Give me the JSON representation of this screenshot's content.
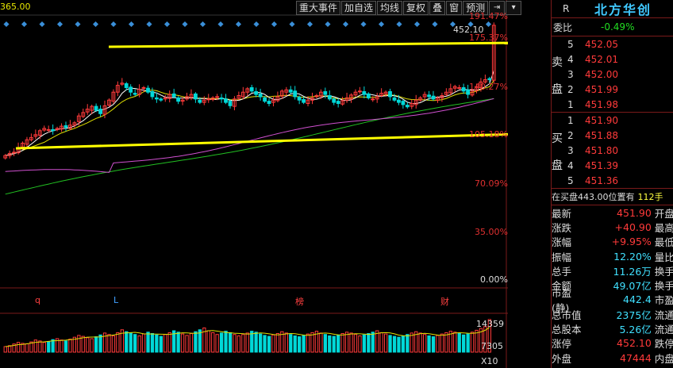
{
  "ma_tag": "365.00",
  "toolbar": {
    "buttons": [
      "重大事件",
      "加自选",
      "均线",
      "复权",
      "叠",
      "窗",
      "预测"
    ],
    "icon_pin": "⇥",
    "icon_drop": "▾"
  },
  "axis_right": {
    "pct_labels": [
      "191.47%",
      "175.37%",
      "140.27%",
      "105.18%",
      "70.09%",
      "35.00%",
      "0.00%"
    ],
    "volume_labels": [
      "14359",
      "7305",
      "X10"
    ]
  },
  "last_price_label": "452.10",
  "event_markers": [
    "q",
    "L",
    "榜",
    "财"
  ],
  "panel": {
    "flag": "R",
    "stock_name": "北方华创",
    "weibi_label": "委比",
    "weibi_value": "-0.49%",
    "sell_label": [
      "卖",
      "盘"
    ],
    "buy_label": [
      "买",
      "盘"
    ],
    "sell_orders": [
      {
        "n": "5",
        "price": "452.05"
      },
      {
        "n": "4",
        "price": "452.01"
      },
      {
        "n": "3",
        "price": "452.00"
      },
      {
        "n": "2",
        "price": "451.99"
      },
      {
        "n": "1",
        "price": "451.98"
      }
    ],
    "buy_orders": [
      {
        "n": "1",
        "price": "451.90"
      },
      {
        "n": "2",
        "price": "451.88"
      },
      {
        "n": "3",
        "price": "451.80"
      },
      {
        "n": "4",
        "price": "451.39"
      },
      {
        "n": "5",
        "price": "451.36"
      }
    ],
    "notice": {
      "text": "在买盘443.00位置有",
      "qty": "112手"
    },
    "stats": [
      {
        "k": "最新",
        "v": "451.90",
        "c": "red",
        "k2": "开盘"
      },
      {
        "k": "涨跌",
        "v": "+40.90",
        "c": "red",
        "k2": "最高"
      },
      {
        "k": "涨幅",
        "v": "+9.95%",
        "c": "red",
        "k2": "最低"
      },
      {
        "k": "振幅",
        "v": "12.20%",
        "c": "cyan",
        "k2": "量比"
      },
      {
        "k": "总手",
        "v": "11.26万",
        "c": "cyan",
        "k2": "换手"
      },
      {
        "k": "金额",
        "v": "49.07亿",
        "c": "cyan",
        "k2": "换手"
      },
      {
        "k": "市盈(静)",
        "v": "442.4",
        "c": "cyan",
        "k2": "市盈"
      },
      {
        "k": "总市值",
        "v": "2375亿",
        "c": "cyan",
        "k2": "流通"
      },
      {
        "k": "总股本",
        "v": "5.26亿",
        "c": "cyan",
        "k2": "流通"
      },
      {
        "k": "涨停",
        "v": "452.10",
        "c": "red",
        "k2": "跌停"
      },
      {
        "k": "外盘",
        "v": "47444",
        "c": "red",
        "k2": "内盘"
      }
    ]
  },
  "colors": {
    "up": "#ff3a3a",
    "down": "#00d8d8",
    "arrow": "#ffff00"
  },
  "series": {
    "closes": [
      218,
      222,
      224,
      232,
      240,
      246,
      250,
      255,
      262,
      266,
      264,
      262,
      266,
      270,
      268,
      272,
      276,
      288,
      294,
      300,
      305,
      298,
      292,
      306,
      316,
      330,
      342,
      346,
      338,
      330,
      326,
      335,
      338,
      330,
      322,
      318,
      316,
      320,
      326,
      322,
      314,
      316,
      322,
      326,
      318,
      312,
      316,
      318,
      320,
      322,
      318,
      312,
      306,
      318,
      324,
      330,
      336,
      332,
      326,
      322,
      314,
      310,
      316,
      322,
      332,
      334,
      330,
      322,
      316,
      312,
      316,
      320,
      324,
      330,
      326,
      318,
      312,
      310,
      315,
      320,
      325,
      330,
      332,
      326,
      320,
      318,
      322,
      328,
      330,
      322,
      316,
      312,
      308,
      304,
      310,
      316,
      320,
      326,
      322,
      318,
      320,
      324,
      330,
      336,
      340,
      338,
      332,
      326,
      332,
      340,
      348,
      352,
      352,
      448
    ],
    "volumes": [
      2400,
      2800,
      3500,
      4200,
      3800,
      3600,
      4400,
      5200,
      4800,
      4200,
      4600,
      5400,
      5800,
      5200,
      4800,
      5600,
      6400,
      7200,
      6800,
      6200,
      5800,
      6600,
      7400,
      8200,
      7600,
      7000,
      8400,
      9600,
      8800,
      8200,
      7600,
      7000,
      7800,
      8600,
      8000,
      7400,
      6800,
      7600,
      8400,
      9200,
      8600,
      7800,
      7200,
      8000,
      8800,
      9600,
      10400,
      9200,
      8400,
      7600,
      8200,
      9000,
      8400,
      7600,
      7000,
      7600,
      8200,
      9000,
      8600,
      7800,
      7200,
      6800,
      7400,
      8000,
      8800,
      8200,
      7600,
      7000,
      6600,
      7200,
      7800,
      8400,
      9000,
      8200,
      7600,
      7000,
      6800,
      7400,
      8000,
      8600,
      8200,
      7600,
      7000,
      7400,
      8000,
      8600,
      9200,
      8400,
      7800,
      7200,
      6800,
      6400,
      7000,
      7600,
      8200,
      8800,
      8200,
      7600,
      7000,
      6600,
      7200,
      7800,
      8400,
      9000,
      8600,
      8000,
      7400,
      7800,
      8600,
      9400,
      10200,
      11000,
      14000
    ]
  }
}
